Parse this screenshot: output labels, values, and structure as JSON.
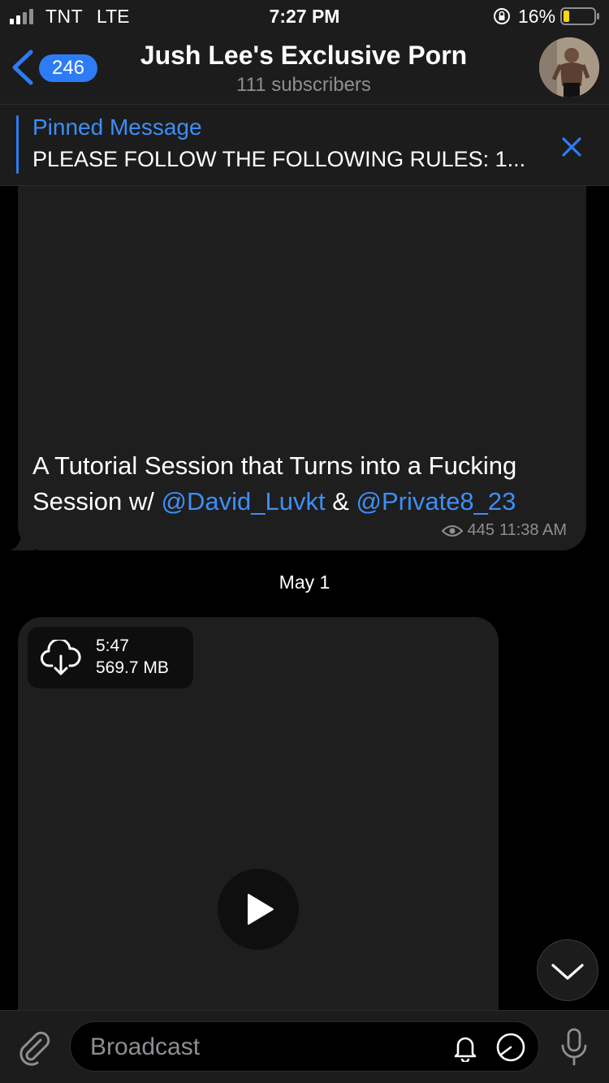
{
  "status_bar": {
    "carrier": "TNT",
    "network": "LTE",
    "time": "7:27 PM",
    "battery_percent": "16%"
  },
  "header": {
    "back_badge": "246",
    "title": "Jush Lee's Exclusive Porn",
    "subtitle": "111 subscribers"
  },
  "pinned": {
    "title": "Pinned Message",
    "text": "PLEASE FOLLOW THE FOLLOWING RULES: 1..."
  },
  "messages": [
    {
      "text_before": "A Tutorial Session that Turns into a Fucking Session w/ ",
      "mention_1": "@David_Luvkt",
      "between": " & ",
      "mention_2": "@Private8_23",
      "views": "445",
      "time": "11:38 AM"
    }
  ],
  "date_separator": "May 1",
  "video": {
    "duration": "5:47",
    "size": "569.7 MB"
  },
  "input": {
    "placeholder": "Broadcast"
  },
  "colors": {
    "accent": "#2d7cf6",
    "bubble": "#1e1e1e",
    "bar": "#1c1c1d"
  },
  "icons": [
    "signal-icon",
    "orientation-lock-icon",
    "battery-icon",
    "back-chevron-icon",
    "close-icon",
    "eye-icon",
    "cloud-download-icon",
    "play-icon",
    "chevron-down-icon",
    "paperclip-icon",
    "bell-icon",
    "timer-icon",
    "microphone-icon"
  ]
}
